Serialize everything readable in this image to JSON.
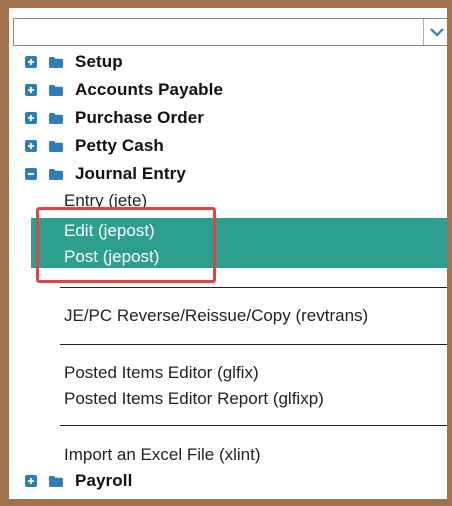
{
  "dropdown": {
    "value": "",
    "icon": "chevron-down-icon"
  },
  "tree": {
    "setup": {
      "label": "Setup",
      "state": "collapsed"
    },
    "accounts_payable": {
      "label": "Accounts Payable",
      "state": "collapsed"
    },
    "purchase_order": {
      "label": "Purchase Order",
      "state": "collapsed"
    },
    "petty_cash": {
      "label": "Petty Cash",
      "state": "collapsed"
    },
    "journal_entry": {
      "label": "Journal Entry",
      "state": "expanded"
    },
    "payroll": {
      "label": "Payroll",
      "state": "collapsed"
    }
  },
  "journal_items": {
    "entry": "Entry (jete)",
    "edit": "Edit (jepost)",
    "post": "Post (jepost)",
    "reverse": "JE/PC Reverse/Reissue/Copy (revtrans)",
    "posted_editor": "Posted Items Editor (glfix)",
    "posted_editor_report": "Posted Items Editor Report (glfixp)",
    "import_excel": "Import an Excel File (xlint)"
  },
  "colors": {
    "frame": "#a0714a",
    "selection": "#2d9f8e",
    "expander": "#2e7fb8",
    "folder": "#2e7fb8",
    "highlight_border": "#e04545"
  }
}
